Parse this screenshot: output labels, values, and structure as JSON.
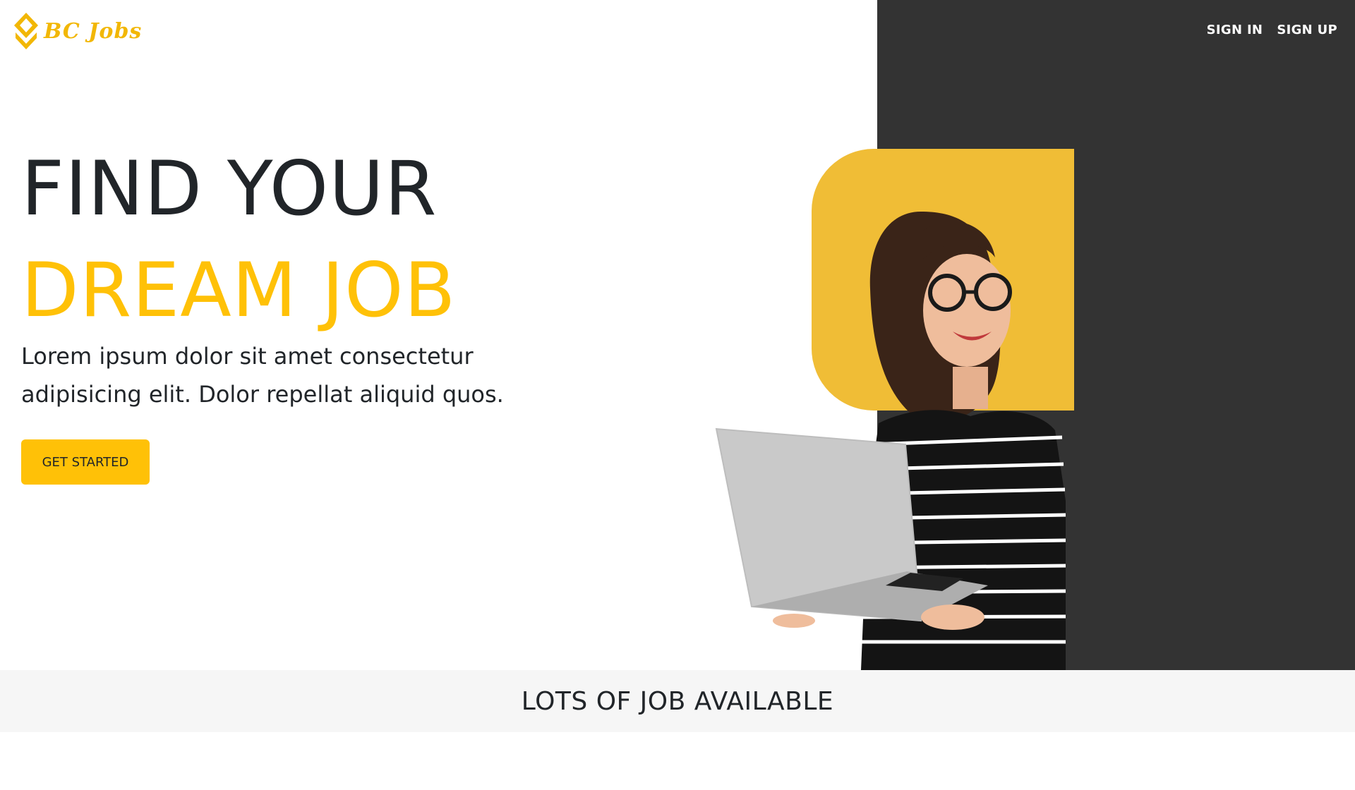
{
  "brand": {
    "name": "BC Jobs",
    "logo_icon": "diamond-pin-icon",
    "color": "#f2b705"
  },
  "nav": {
    "sign_in": "SIGN IN",
    "sign_up": "SIGN UP"
  },
  "hero": {
    "title_line1": "FIND YOUR",
    "title_line2": "DREAM JOB",
    "description": "Lorem ipsum dolor sit amet consectetur adipisicing elit. Dolor repellat aliquid quos.",
    "cta_label": "GET STARTED"
  },
  "section": {
    "title": "LOTS OF JOB AVAILABLE"
  },
  "colors": {
    "accent": "#ffc107",
    "dark_panel": "#333333",
    "yellow_block": "#f0bd36",
    "band": "#f6f6f6"
  }
}
